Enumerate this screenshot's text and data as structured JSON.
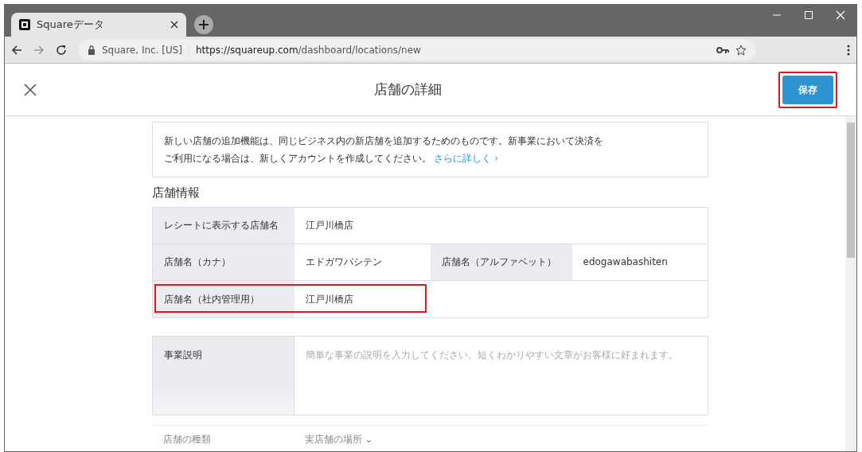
{
  "browser": {
    "tab": {
      "title": "Squareデータ",
      "selected": true
    },
    "security_label": "Square, Inc. [US]",
    "url_host": "https://squareup.com",
    "url_path": "/dashboard/locations/new"
  },
  "header": {
    "title": "店舗の詳細",
    "save_button": {
      "label": "保存",
      "highlighted": true
    }
  },
  "notice": {
    "text": "新しい店舗の追加機能は、同じビジネス内の新店舗を追加するためのものです。新事業において決済をご利用になる場合は、新しくアカウントを作成してください。",
    "link": "さらに詳しく ›"
  },
  "section_title": "店舗情報",
  "info_rows": [
    {
      "highlighted": false,
      "cells": [
        {
          "label": "レシートに表示する店舗名",
          "value": "江戸川橋店"
        }
      ]
    },
    {
      "highlighted": false,
      "cells": [
        {
          "label": "店舗名（カナ）",
          "value": "エドガワバシテン"
        },
        {
          "label": "店舗名（アルファベット）",
          "value": "edogawabashiten"
        }
      ]
    },
    {
      "highlighted": true,
      "cells": [
        {
          "label": "店舗名（社内管理用）",
          "value": "江戸川橋店"
        }
      ]
    }
  ],
  "description": {
    "label": "事業説明",
    "placeholder": "簡単な事業の説明を入力してください。短くわかりやすい文章がお客様に好まれます。"
  },
  "faded_row": {
    "label": "店舗の種類",
    "value": "実店舗の場所 ⌄"
  }
}
